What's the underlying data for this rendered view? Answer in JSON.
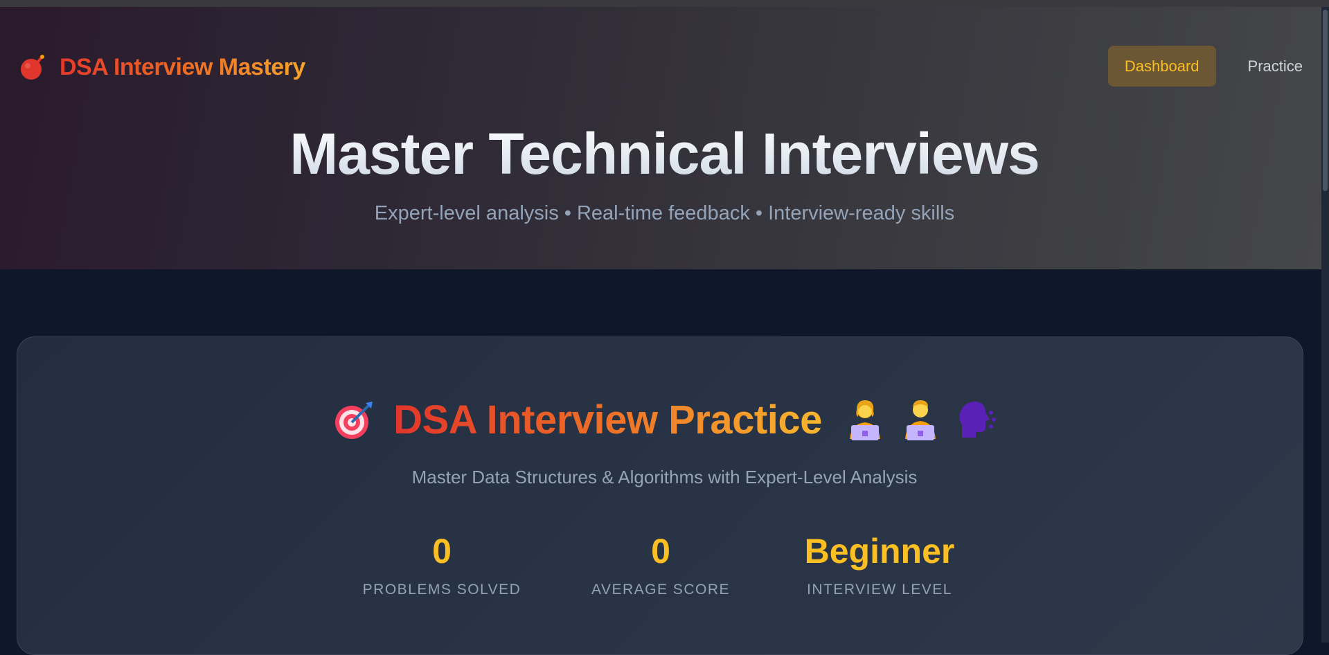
{
  "brand": {
    "title": "DSA Interview Mastery",
    "icon": "bomb-icon"
  },
  "nav": {
    "items": [
      {
        "label": "Dashboard",
        "active": true
      },
      {
        "label": "Practice",
        "active": false
      }
    ]
  },
  "hero": {
    "title": "Master Technical Interviews",
    "subtitle": "Expert-level analysis • Real-time feedback • Interview-ready skills"
  },
  "practice_card": {
    "title": "DSA Interview Practice",
    "leading_icon": "target-icon",
    "trailing_icons": [
      "woman-technologist-icon",
      "man-technologist-icon",
      "speaking-head-icon"
    ],
    "subtitle": "Master Data Structures & Algorithms with Expert-Level Analysis",
    "stats": [
      {
        "value": "0",
        "label": "PROBLEMS SOLVED"
      },
      {
        "value": "0",
        "label": "AVERAGE SCORE"
      },
      {
        "value": "Beginner",
        "label": "INTERVIEW LEVEL"
      }
    ]
  },
  "colors": {
    "accent": "#fbbf24",
    "brand_gradient_start": "#e33a2b",
    "brand_gradient_end": "#f7a52a",
    "page_background": "#0f172a"
  }
}
